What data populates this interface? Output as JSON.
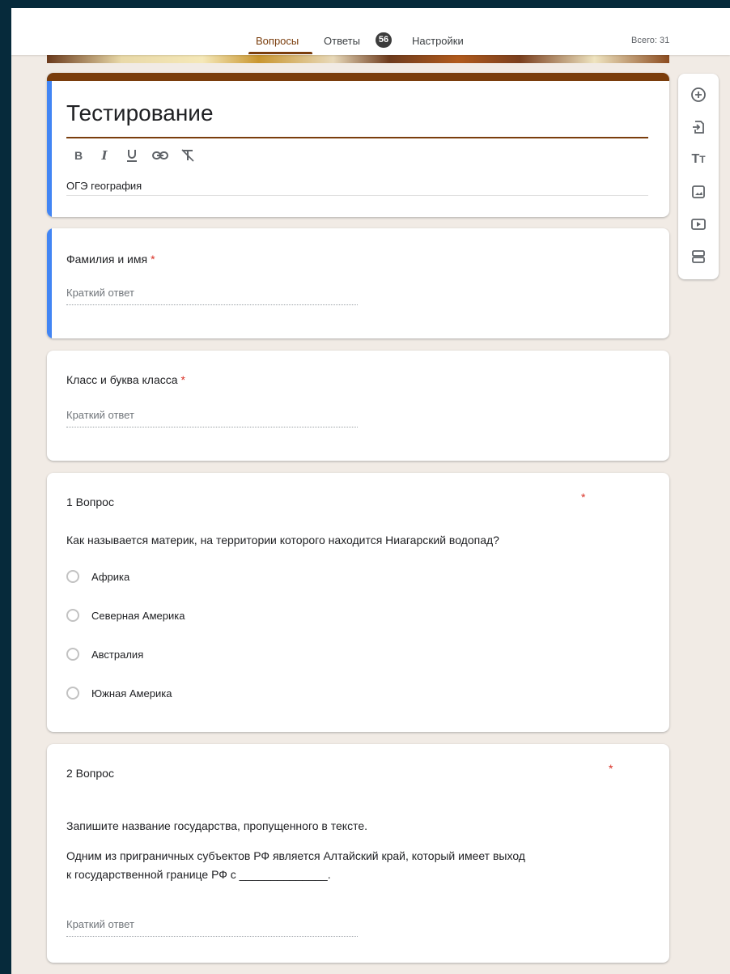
{
  "tabs": {
    "questions": "Вопросы",
    "responses": "Ответы",
    "responses_count": "56",
    "settings": "Настройки"
  },
  "total_points": "Всего: 31",
  "form": {
    "title": "Тестирование",
    "description": "ОГЭ география"
  },
  "format_icons": [
    "bold-icon",
    "italic-icon",
    "underline-icon",
    "link-icon",
    "clear-format-icon"
  ],
  "questions": [
    {
      "title": "Фамилия и имя",
      "required_mark": "*",
      "placeholder": "Краткий ответ"
    },
    {
      "title": "Класс и буква класса",
      "required_mark": "*",
      "placeholder": "Краткий ответ"
    },
    {
      "title": "1 Вопрос",
      "required_mark": "*",
      "text": "Как называется материк, на территории которого находится Ниагарский водопад?",
      "options": [
        "Африка",
        "Северная Америка",
        "Австралия",
        "Южная Америка"
      ]
    },
    {
      "title": "2 Вопрос",
      "required_mark": "*",
      "text_line1": "Запишите название государства, пропущенного в тексте.",
      "text_line2": "Одним из приграничных субъектов РФ является Алтайский край, который имеет выход",
      "text_line3": "к государственной границе РФ с ______________.",
      "placeholder": "Краткий ответ"
    }
  ],
  "toolbar_icons": [
    "add-question-icon",
    "import-questions-icon",
    "add-title-icon",
    "add-image-icon",
    "add-video-icon",
    "add-section-icon"
  ],
  "colors": {
    "theme": "#7a3d0c",
    "active_bar": "#4285f4",
    "background": "#f1ebe5",
    "required": "#d93025"
  }
}
